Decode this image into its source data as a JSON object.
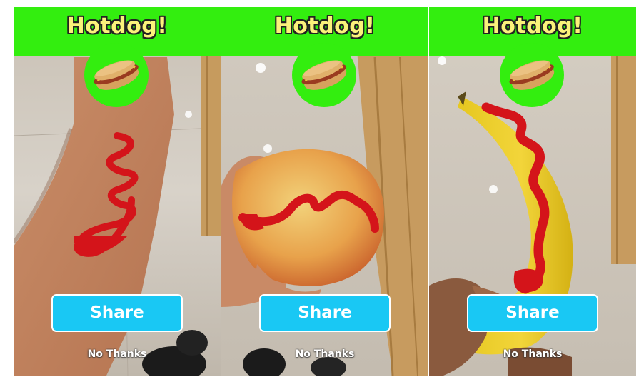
{
  "screens": [
    {
      "title": "Hotdog!",
      "share_label": "Share",
      "dismiss_label": "No Thanks",
      "photo_subject": "arm"
    },
    {
      "title": "Hotdog!",
      "share_label": "Share",
      "dismiss_label": "No Thanks",
      "photo_subject": "apple"
    },
    {
      "title": "Hotdog!",
      "share_label": "Share",
      "dismiss_label": "No Thanks",
      "photo_subject": "banana"
    }
  ],
  "colors": {
    "banner": "#33ee0f",
    "title_fill": "#fbf27a",
    "share_button": "#19c8f4",
    "ketchup": "#d4141a"
  },
  "icons": {
    "badge": "hotdog-icon"
  }
}
